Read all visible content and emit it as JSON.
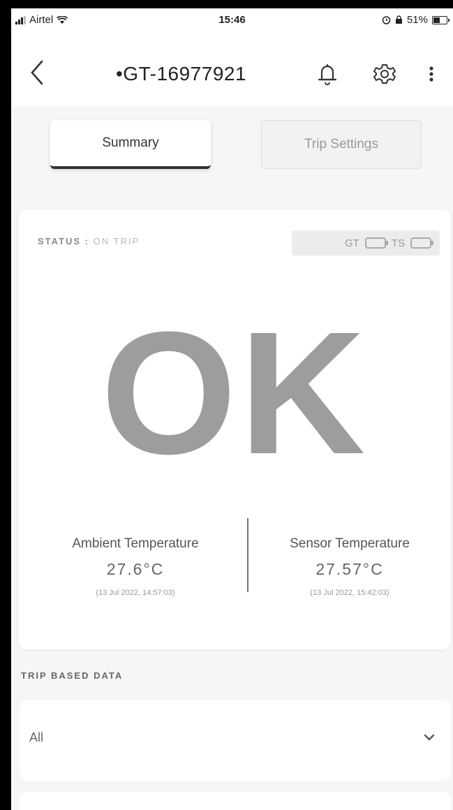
{
  "status_bar": {
    "carrier": "Airtel",
    "time": "15:46",
    "battery": "51%",
    "battery_level": 0.51,
    "icons": [
      "signal-icon",
      "wifi-icon",
      "alarm-icon",
      "lock-icon",
      "battery-charging-icon"
    ]
  },
  "header": {
    "title": "•GT-16977921",
    "icons": [
      "back-icon",
      "bell-icon",
      "gear-icon",
      "more-vertical-icon"
    ]
  },
  "tabs": [
    {
      "label": "Summary",
      "active": true
    },
    {
      "label": "Trip Settings",
      "active": false
    }
  ],
  "status_card": {
    "status_label": "STATUS :",
    "status_value": "ON TRIP",
    "device_gt": "GT",
    "device_ts": "TS",
    "big_status": "OK",
    "ambient": {
      "label": "Ambient Temperature",
      "value": "27.6°C",
      "time": "(13 Jul 2022, 14:57:03)"
    },
    "sensor": {
      "label": "Sensor Temperature",
      "value": "27.57°C",
      "time": "(13 Jul 2022, 15:42:03)"
    }
  },
  "trip_data": {
    "title": "TRIP BASED DATA",
    "filter_value": "All",
    "icon": "chevron-down-icon"
  },
  "colors": {
    "accent": "#333333",
    "status_text": "#9d9d9d",
    "background": "#f6f6f6"
  }
}
